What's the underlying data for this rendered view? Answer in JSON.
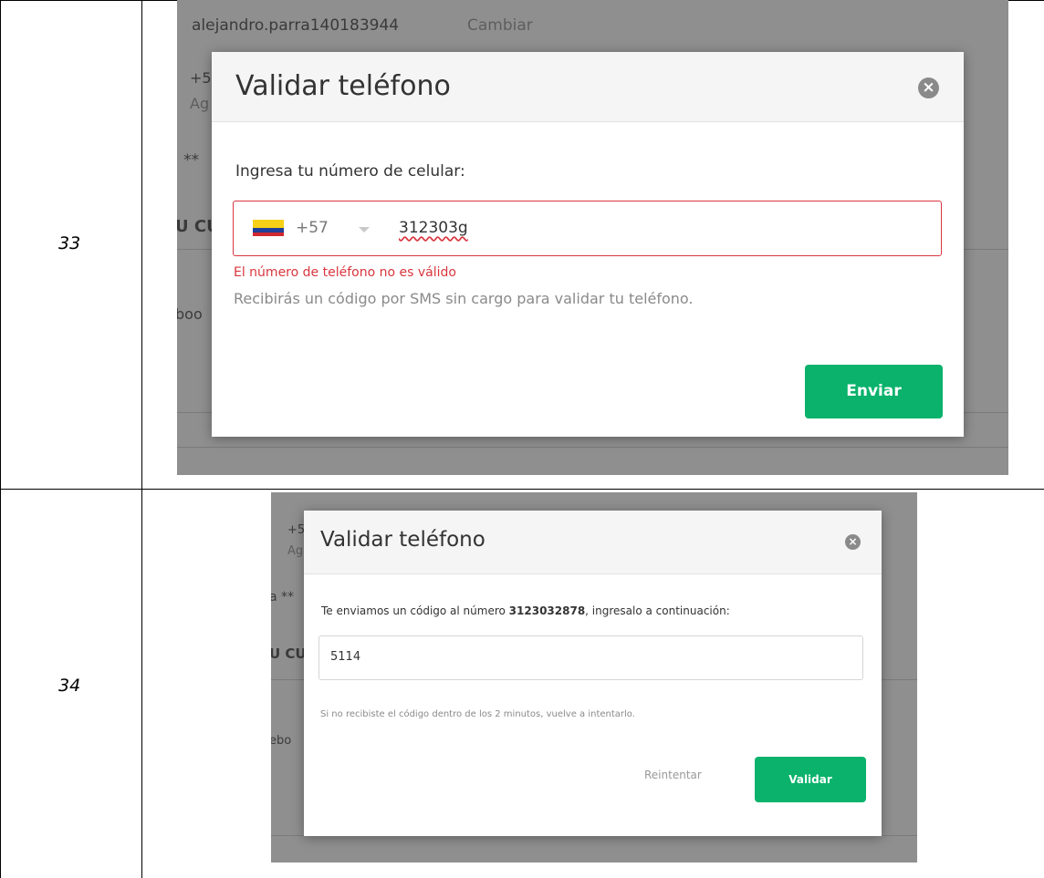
{
  "rows": [
    {
      "step": "33",
      "background": {
        "username": "alejandro.parra140183944",
        "change_link": "Cambiar",
        "partial_1": "+5",
        "partial_2": "Ag",
        "partial_3": ": **",
        "partial_4": "U CU",
        "partial_5": "boo"
      },
      "modal": {
        "title": "Validar teléfono",
        "close_icon": "×",
        "prompt": "Ingresa tu número de celular:",
        "country_flag": "colombia-flag",
        "dial_code": "+57",
        "phone_value": "312303g",
        "error": "El número de teléfono no es válido",
        "help": "Recibirás un código por SMS sin cargo para validar tu teléfono.",
        "send_button": "Enviar"
      }
    },
    {
      "step": "34",
      "background": {
        "partial_1": "+5",
        "partial_2": "Ag",
        "partial_3": "a **",
        "partial_4": "U CU",
        "partial_5": "ebo"
      },
      "modal": {
        "title": "Validar teléfono",
        "close_icon": "×",
        "prompt_before": "Te enviamos un código al número ",
        "phone_number": "3123032878",
        "prompt_after": ", ingresalo a continuación:",
        "code_value": "5114",
        "help": "Si no recibiste el código dentro de los 2 minutos, vuelve a intentarlo.",
        "retry_link": "Reintentar",
        "validate_button": "Validar"
      }
    }
  ],
  "colors": {
    "accent_green": "#0ab26b",
    "error_red": "#d9363e",
    "overlay_gray": "#8f8f8f"
  }
}
